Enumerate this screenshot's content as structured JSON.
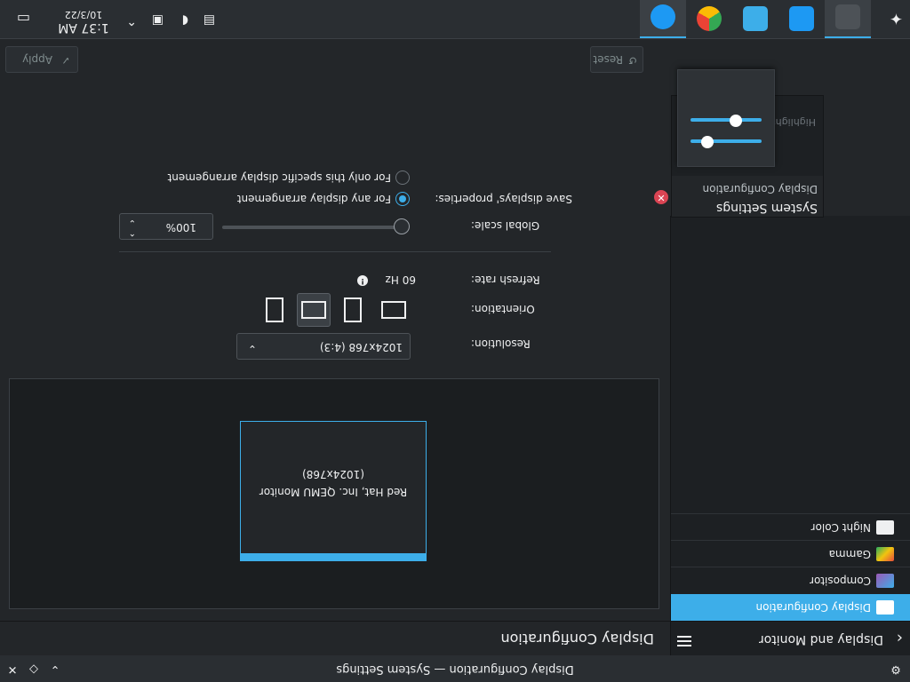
{
  "window": {
    "title": "Display Configuration — System Settings",
    "controls": [
      "minimize",
      "maximize",
      "close"
    ]
  },
  "sidebar": {
    "back_icon": "chevron-left-icon",
    "title": "Display and Monitor",
    "menu_icon": "hamburger-menu-icon",
    "items": [
      {
        "label": "Display Configuration",
        "icon": "display-icon",
        "active": true,
        "color": "#ffffff"
      },
      {
        "label": "Compositor",
        "icon": "compositor-icon",
        "active": false,
        "color": "#3daee9"
      },
      {
        "label": "Gamma",
        "icon": "gamma-icon",
        "active": false,
        "color": "#e67e22"
      },
      {
        "label": "Night Color",
        "icon": "night-color-icon",
        "active": false,
        "color": "#eff0f1"
      }
    ]
  },
  "main": {
    "title": "Display Configuration",
    "monitor": {
      "name": "Red Hat, Inc. QEMU Monitor",
      "resolution_label": "(1024x768)"
    },
    "resolution": {
      "label": "Resolution:",
      "value": "1024x768 (4:3)"
    },
    "orientation": {
      "label": "Orientation:",
      "options": [
        "landscape-icon",
        "portrait-icon",
        "landscape-flipped-icon",
        "portrait-flipped-icon"
      ],
      "selected": 0
    },
    "refresh": {
      "label": "Refresh rate:",
      "value": "60 Hz",
      "icon": "info-icon"
    },
    "global_scale": {
      "label": "Global scale:",
      "value": "100%",
      "slider_fraction": 0.0
    },
    "save_properties": {
      "label": "Save displays' properties:",
      "options": [
        "For any display arrangement",
        "For only this specific display arrangement"
      ],
      "selected": 0
    },
    "buttons": {
      "reset": "Reset",
      "apply": "Apply",
      "reset_icon": "reset-icon",
      "apply_icon": "check-icon"
    }
  },
  "popup": {
    "title": "System Settings",
    "subtitle": "Display Configuration",
    "close_icon": "close-circle-icon",
    "tooltip_partial": "Highlight Changed Settings"
  },
  "taskbar": {
    "launcher_icon": "kde-launcher-icon",
    "apps": [
      {
        "name": "system-settings-icon",
        "active": true
      },
      {
        "name": "discover-icon",
        "active": false
      },
      {
        "name": "desktop-icon",
        "active": false
      },
      {
        "name": "chrome-icon",
        "active": false
      },
      {
        "name": "thunderbird-icon",
        "active": true
      }
    ],
    "tray": [
      "clipboard-icon",
      "volume-icon",
      "network-icon",
      "expand-tray-icon"
    ],
    "clock": {
      "time": "1:37 AM",
      "date": "10/3/22"
    },
    "show_desktop_icon": "show-desktop-icon"
  }
}
